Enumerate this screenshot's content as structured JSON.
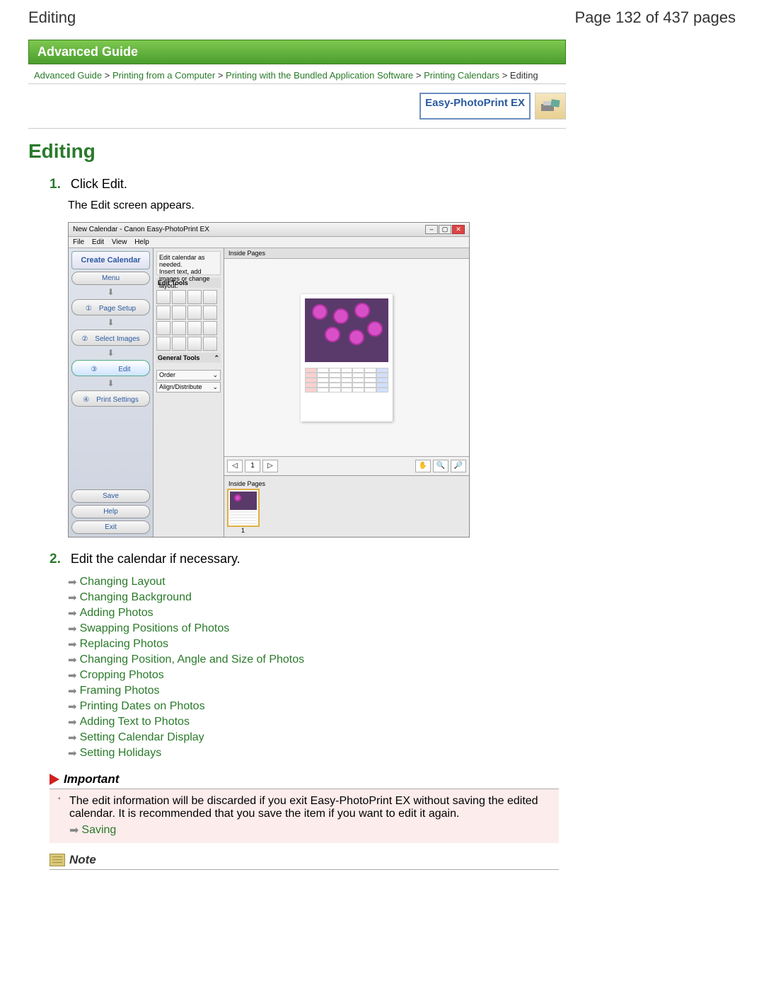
{
  "header": {
    "left": "Editing",
    "right": "Page 132 of 437 pages"
  },
  "banner": "Advanced Guide",
  "breadcrumb": {
    "items": [
      "Advanced Guide",
      "Printing from a Computer",
      "Printing with the Bundled Application Software",
      "Printing Calendars"
    ],
    "current": "Editing",
    "sep": ">"
  },
  "badge": "Easy-PhotoPrint EX",
  "title": "Editing",
  "steps": [
    {
      "num": "1.",
      "text": "Click Edit.",
      "sub": "The Edit screen appears."
    },
    {
      "num": "2.",
      "text": "Edit the calendar if necessary."
    }
  ],
  "screenshot": {
    "title": "New Calendar - Canon Easy-PhotoPrint EX",
    "menus": [
      "File",
      "Edit",
      "View",
      "Help"
    ],
    "hint1": "Edit calendar as needed.",
    "hint2": "Insert text, add images or change layout.",
    "left": {
      "header": "Create Calendar",
      "steps": [
        "Menu",
        "①　Page Setup",
        "②　Select Images",
        "③　　　Edit",
        "④　Print Settings"
      ],
      "bottom": [
        "Save",
        "Help",
        "Exit"
      ]
    },
    "mid": {
      "editTools": "Edit Tools",
      "generalTools": "General Tools",
      "order": "Order",
      "align": "Align/Distribute"
    },
    "right": {
      "tab": "Inside Pages",
      "pageNum": "1",
      "thumbLabel": "Inside Pages",
      "thumbNum": "1"
    }
  },
  "editLinks": [
    "Changing Layout",
    "Changing Background",
    "Adding Photos",
    "Swapping Positions of Photos",
    "Replacing Photos",
    "Changing Position, Angle and Size of Photos",
    "Cropping Photos",
    "Framing Photos",
    "Printing Dates on Photos",
    "Adding Text to Photos",
    "Setting Calendar Display",
    "Setting Holidays"
  ],
  "important": {
    "label": "Important",
    "text": "The edit information will be discarded if you exit Easy-PhotoPrint EX without saving the edited calendar. It is recommended that you save the item if you want to edit it again.",
    "saving": "Saving"
  },
  "note": {
    "label": "Note"
  }
}
